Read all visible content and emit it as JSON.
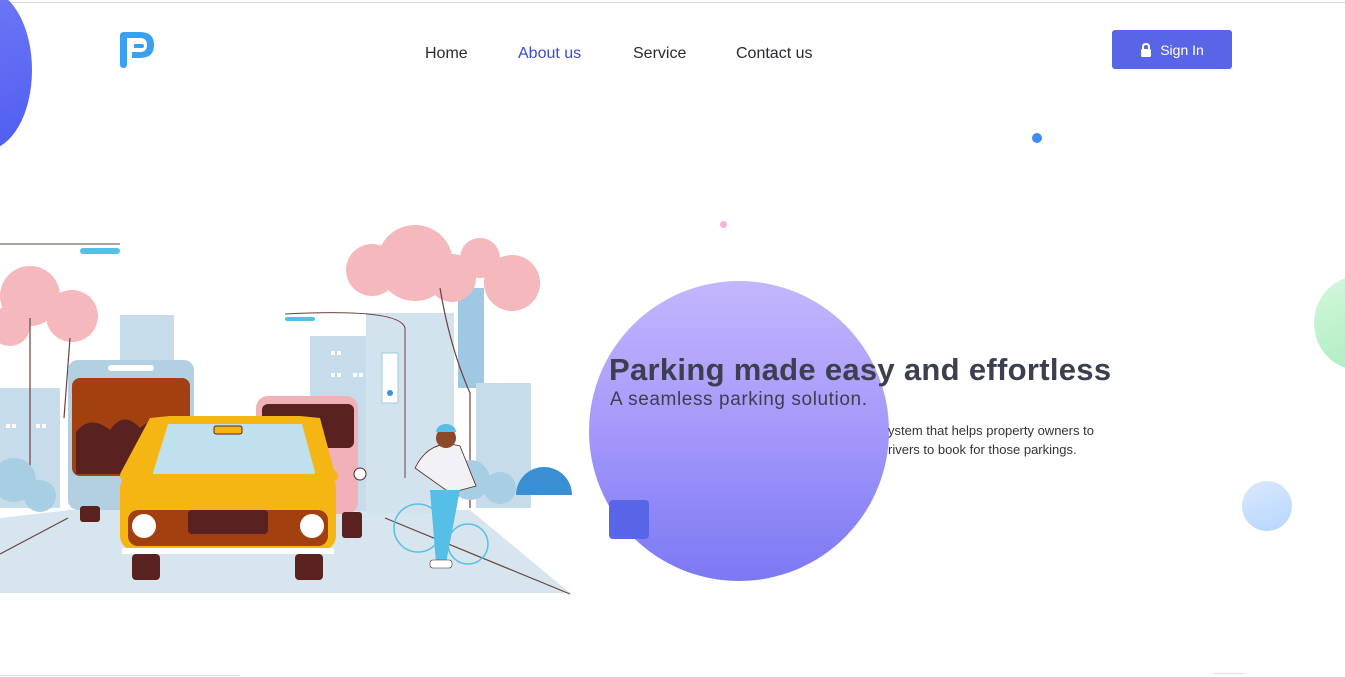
{
  "brand": {
    "logo_icon": "p-letter-logo",
    "accent": "#5865e6",
    "logo_color": "#3aa0ef"
  },
  "nav": {
    "items": [
      {
        "label": "Home",
        "active": false
      },
      {
        "label": "About us",
        "active": true
      },
      {
        "label": "Service",
        "active": false
      },
      {
        "label": "Contact us",
        "active": false
      }
    ]
  },
  "header": {
    "signin_label": "Sign In",
    "signin_icon": "lock-icon"
  },
  "hero": {
    "title": "Parking made easy and effortless",
    "subtitle": "A seamless parking solution.",
    "description_line1": "ystem that helps property owners to",
    "description_line2": "rivers to book for those parkings."
  },
  "illustration": {
    "name": "city-traffic-illustration"
  }
}
